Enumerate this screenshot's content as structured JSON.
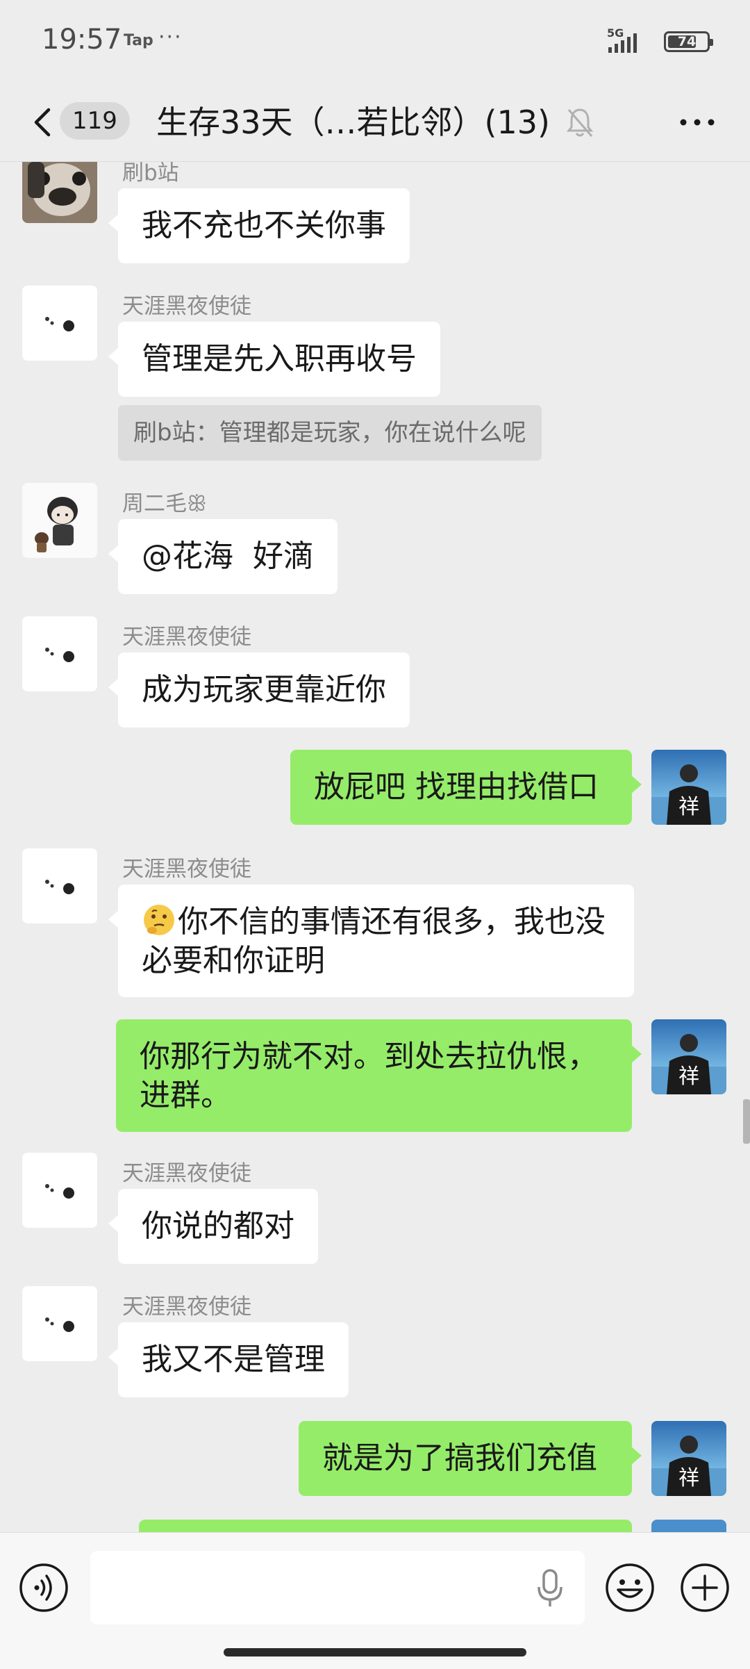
{
  "status_bar": {
    "time": "19:57",
    "app_tag": "Tap",
    "more_dots": "···",
    "network": "5G",
    "battery": "74",
    "battery_level": 0.74
  },
  "header": {
    "unread_count": "119",
    "title": "生存33天（…若比邻）(13)",
    "icons": [
      "back-icon",
      "mute-bell-icon",
      "more-icon"
    ]
  },
  "messages": [
    {
      "direction": "in",
      "sender": "刷b站",
      "avatar": "dog-avatar",
      "text": "我不充也不关你事"
    },
    {
      "direction": "in",
      "sender": "天涯黑夜使徒",
      "avatar": "dots-avatar",
      "text": "管理是先入职再收号",
      "quote": "刷b站：管理都是玩家，你在说什么呢"
    },
    {
      "direction": "in",
      "sender": "周二毛ꕥ",
      "avatar": "cartoon-avatar",
      "text": "@花海  好滴"
    },
    {
      "direction": "in",
      "sender": "天涯黑夜使徒",
      "avatar": "dots-avatar",
      "text": "成为玩家更靠近你"
    },
    {
      "direction": "out",
      "avatar": "self-avatar",
      "text": "放屁吧 找理由找借口"
    },
    {
      "direction": "in",
      "sender": "天涯黑夜使徒",
      "avatar": "dots-avatar",
      "emoji": "thinking-face-emoji",
      "text": "你不信的事情还有很多，我也没\n必要和你证明"
    },
    {
      "direction": "out",
      "avatar": "self-avatar",
      "text": "你那行为就不对。到处去拉仇恨，\n进群。"
    },
    {
      "direction": "in",
      "sender": "天涯黑夜使徒",
      "avatar": "dots-avatar",
      "text": "你说的都对"
    },
    {
      "direction": "in",
      "sender": "天涯黑夜使徒",
      "avatar": "dots-avatar",
      "text": "我又不是管理"
    },
    {
      "direction": "out",
      "avatar": "self-avatar",
      "text": "就是为了搞我们充值"
    }
  ],
  "input": {
    "value": "",
    "icons": [
      "voice-icon",
      "mic-icon",
      "emoji-icon",
      "plus-icon"
    ]
  },
  "colors": {
    "background": "#ededed",
    "incoming_bubble": "#ffffff",
    "outgoing_bubble": "#95ec69"
  }
}
